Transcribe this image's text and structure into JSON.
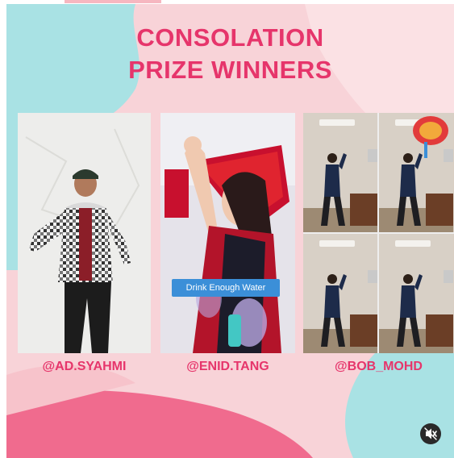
{
  "post": {
    "title_line1": "CONSOLATION",
    "title_line2": "PRIZE WINNERS",
    "winners": [
      {
        "handle": "@AD.SYAHMI"
      },
      {
        "handle": "@ENID.TANG"
      },
      {
        "handle": "@BOB_MOHD"
      }
    ],
    "caption": "Drink Enough Water"
  },
  "controls": {
    "mute_icon": "speaker-muted-icon"
  },
  "colors": {
    "accent": "#e6356b",
    "background_pink": "#f8d3d8",
    "blob_teal": "#a9e2e4",
    "blob_pink": "#f06b8e",
    "caption_blue": "#3b8fd8"
  }
}
